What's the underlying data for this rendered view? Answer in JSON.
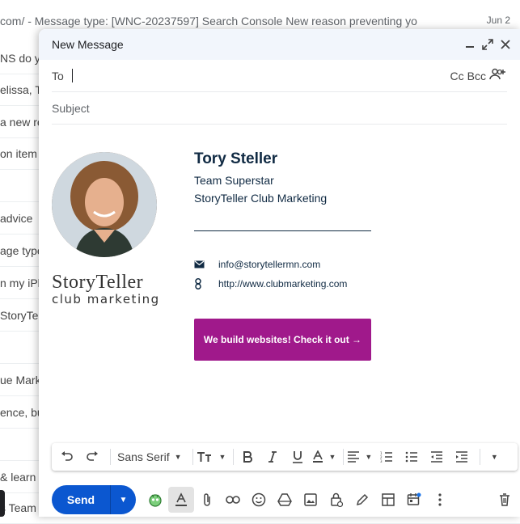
{
  "background": {
    "top_line": "com/ - Message type: [WNC-20237597] Search Console New reason preventing yo",
    "top_date": "Jun 2",
    "rows": [
      "NS do y",
      "elissa, Tr",
      "a new re",
      "on item",
      "",
      "advice",
      "age type",
      "n my iPh",
      "StoryTel",
      "",
      "ue Mark",
      "ence, bu",
      "",
      "",
      "& learn",
      "s Team"
    ]
  },
  "compose": {
    "title": "New Message",
    "to_label": "To",
    "cc_label": "Cc",
    "bcc_label": "Bcc",
    "subject_placeholder": "Subject"
  },
  "signature": {
    "name": "Tory Steller",
    "role": "Team Superstar",
    "org": "StoryTeller Club Marketing",
    "brand_line1": "StoryTeller",
    "brand_line2": "club marketing",
    "email": "info@storytellermn.com",
    "website": "http://www.clubmarketing.com",
    "cta": "We build websites! Check it out →",
    "cta_color": "#a0198b",
    "text_color": "#102a43"
  },
  "toolbar": {
    "font": "Sans Serif"
  },
  "bottom": {
    "send_label": "Send",
    "send_color": "#0b57d0"
  }
}
